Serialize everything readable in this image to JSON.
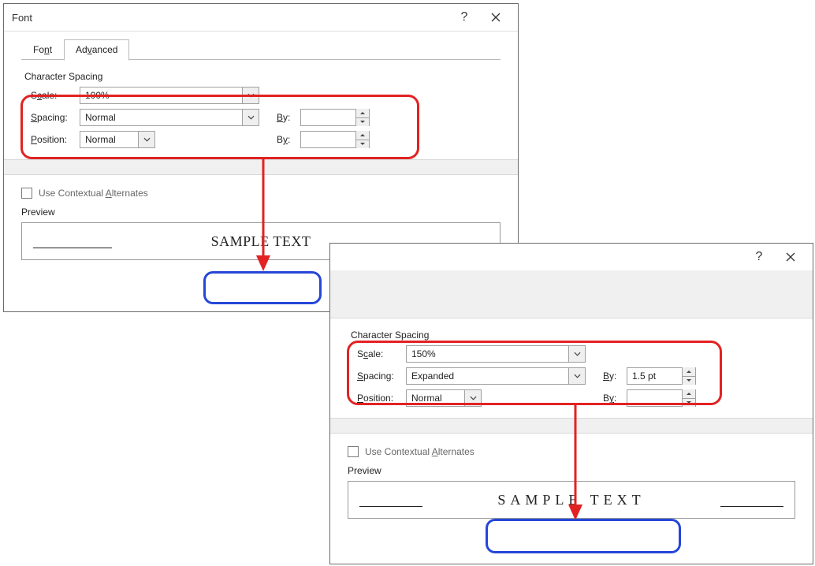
{
  "dialog1": {
    "title": "Font",
    "tabs": {
      "font": "Font",
      "advanced": "Advanced"
    },
    "group_title": "Character Spacing",
    "labels": {
      "scale": "Scale:",
      "spacing": "Spacing:",
      "position": "Position:",
      "by": "By:",
      "contextual": "Use Contextual Alternates",
      "preview": "Preview"
    },
    "values": {
      "scale": "100%",
      "spacing": "Normal",
      "position": "Normal",
      "by1": "",
      "by2": ""
    },
    "preview_text": "SAMPLE TEXT"
  },
  "dialog2": {
    "group_title": "Character Spacing",
    "labels": {
      "scale": "Scale:",
      "spacing": "Spacing:",
      "position": "Position:",
      "by": "By:",
      "contextual": "Use Contextual Alternates",
      "preview": "Preview"
    },
    "values": {
      "scale": "150%",
      "spacing": "Expanded",
      "position": "Normal",
      "by1": "1.5 pt",
      "by2": ""
    },
    "preview_text": "SAMPLE TEXT"
  }
}
